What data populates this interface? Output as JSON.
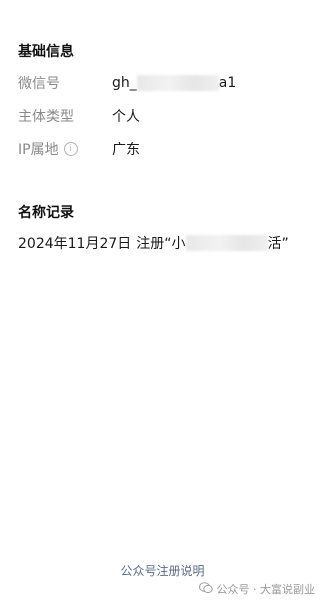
{
  "basic_info": {
    "title": "基础信息",
    "rows": [
      {
        "label": "微信号",
        "value_prefix": "gh_",
        "value_suffix": "a1"
      },
      {
        "label": "主体类型",
        "value": "个人"
      },
      {
        "label": "IP属地",
        "value": "广东"
      }
    ]
  },
  "name_records": {
    "title": "名称记录",
    "entry": {
      "date": "2024年11月27日",
      "action_prefix": "注册“小",
      "action_suffix": "活”"
    }
  },
  "footer": {
    "link": "公众号注册说明"
  },
  "watermark": {
    "text": "公众号 · 大富说副业"
  },
  "icons": {
    "info": "info-icon",
    "watermark": "wechat-icon"
  }
}
